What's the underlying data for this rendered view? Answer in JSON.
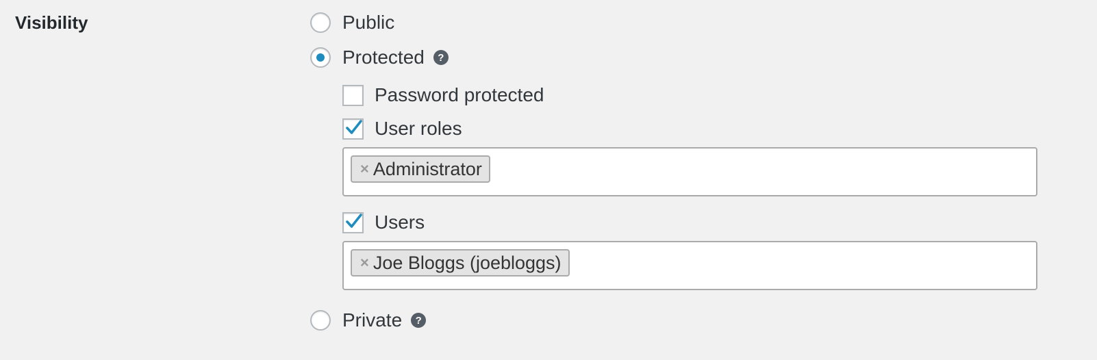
{
  "section": {
    "heading": "Visibility"
  },
  "options": {
    "public": {
      "label": "Public",
      "selected": false
    },
    "protected": {
      "label": "Protected",
      "selected": true,
      "help_glyph": "?"
    },
    "private": {
      "label": "Private",
      "selected": false,
      "help_glyph": "?"
    }
  },
  "protected_settings": {
    "password": {
      "label": "Password protected",
      "checked": false
    },
    "user_roles": {
      "label": "User roles",
      "checked": true,
      "tags": [
        {
          "remove_glyph": "×",
          "label": "Administrator"
        }
      ]
    },
    "users": {
      "label": "Users",
      "checked": true,
      "tags": [
        {
          "remove_glyph": "×",
          "label": "Joe Bloggs (joebloggs)"
        }
      ]
    }
  },
  "colors": {
    "accent": "#1e8cbe",
    "background": "#f1f1f1",
    "help_icon": "#555d66"
  },
  "icons": {
    "help": "question-circle-icon",
    "check": "checkmark-icon",
    "remove": "close-icon"
  }
}
